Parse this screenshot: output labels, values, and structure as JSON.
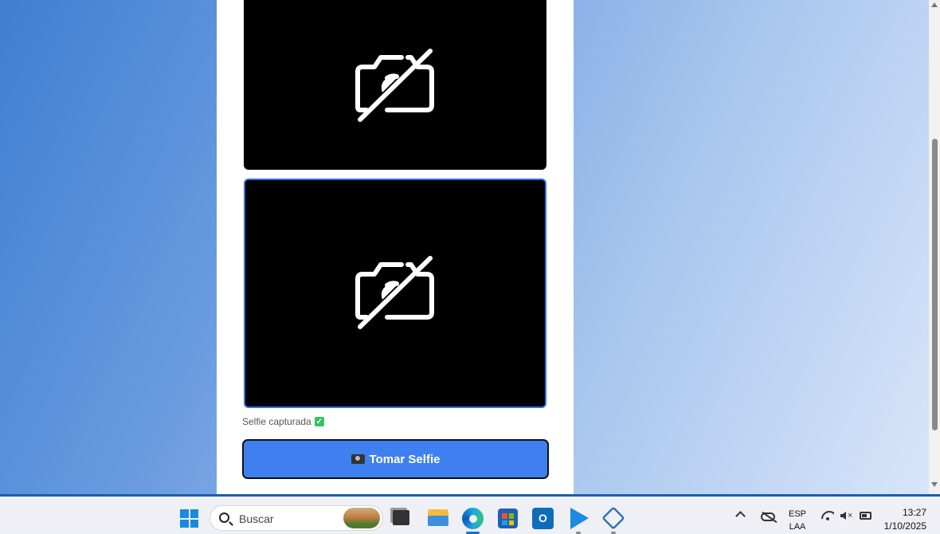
{
  "content": {
    "status_text": "Selfie capturada",
    "status_check": "✓",
    "selfie_button_label": "Tomar Selfie"
  },
  "camera_previews": [
    {
      "state": "camera-off",
      "icon": "camera-off-icon"
    },
    {
      "state": "camera-off",
      "icon": "camera-off-icon"
    }
  ],
  "taskbar": {
    "search_placeholder": "Buscar",
    "outlook_glyph": "O",
    "language": "ESP",
    "layout": "LAA",
    "time": "13:27",
    "date": "1/10/2025",
    "mute_glyph": "×"
  },
  "colors": {
    "button": "#3f80f0",
    "preview_border_active": "#3b6fd8",
    "taskbar_accent": "#1e5ea8"
  }
}
